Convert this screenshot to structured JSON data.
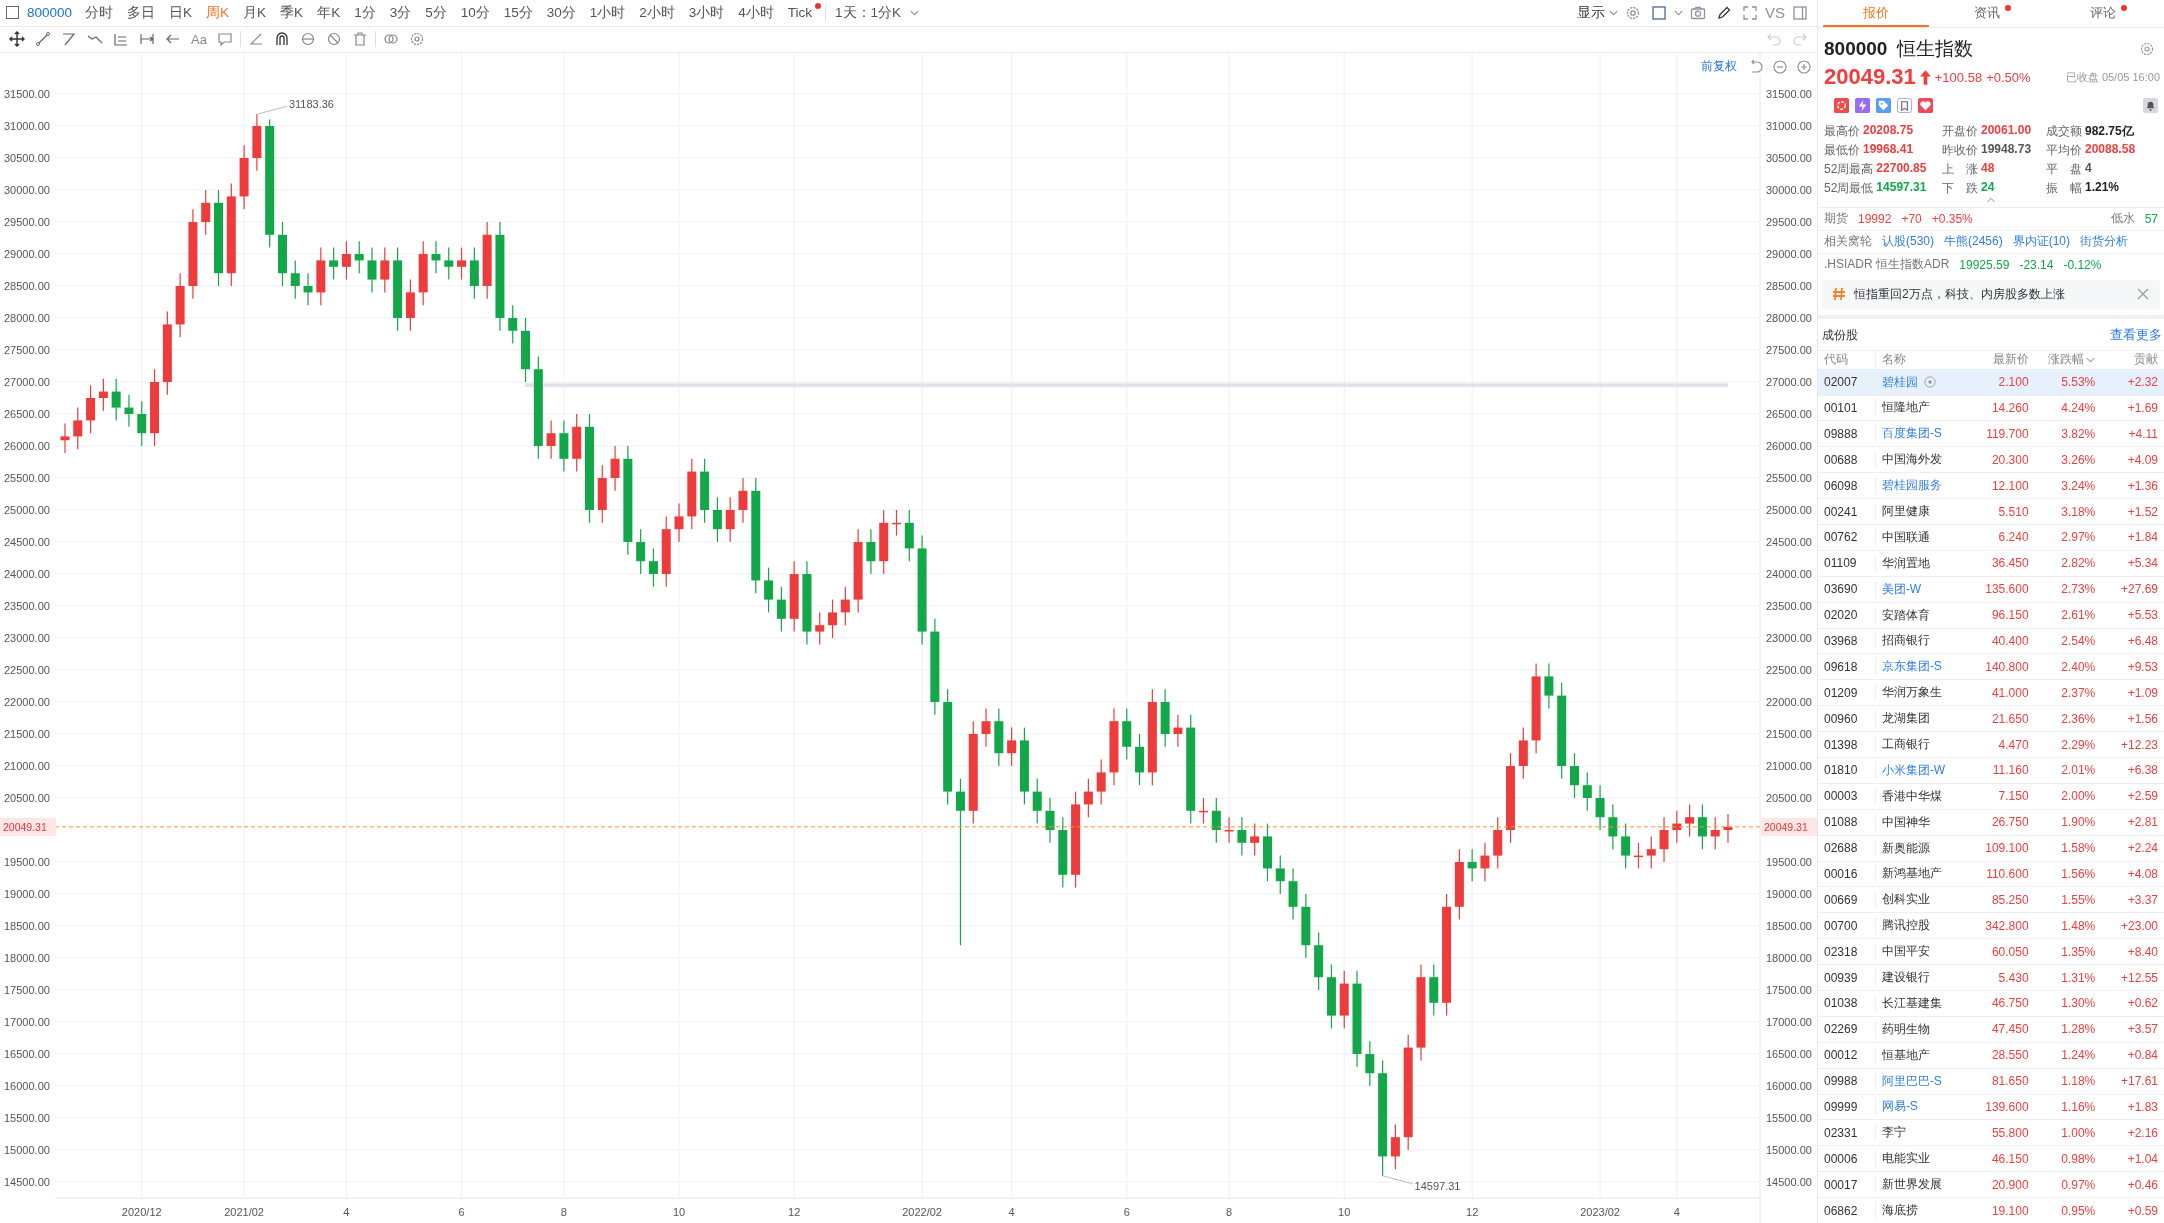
{
  "toolbar": {
    "symbol": "800000",
    "periods": [
      {
        "label": "分时",
        "selected": false,
        "badge": false
      },
      {
        "label": "多日",
        "selected": false,
        "badge": false
      },
      {
        "label": "日K",
        "selected": false,
        "badge": false
      },
      {
        "label": "周K",
        "selected": true,
        "badge": false
      },
      {
        "label": "月K",
        "selected": false,
        "badge": false
      },
      {
        "label": "季K",
        "selected": false,
        "badge": false
      },
      {
        "label": "年K",
        "selected": false,
        "badge": false
      },
      {
        "label": "1分",
        "selected": false,
        "badge": false
      },
      {
        "label": "3分",
        "selected": false,
        "badge": false
      },
      {
        "label": "5分",
        "selected": false,
        "badge": false
      },
      {
        "label": "10分",
        "selected": false,
        "badge": false
      },
      {
        "label": "15分",
        "selected": false,
        "badge": false
      },
      {
        "label": "30分",
        "selected": false,
        "badge": false
      },
      {
        "label": "1小时",
        "selected": false,
        "badge": false
      },
      {
        "label": "2小时",
        "selected": false,
        "badge": false
      },
      {
        "label": "3小时",
        "selected": false,
        "badge": false
      },
      {
        "label": "4小时",
        "selected": false,
        "badge": false
      },
      {
        "label": "Tick",
        "selected": false,
        "badge": true
      }
    ],
    "interval": "1天：1分K",
    "display": "显示",
    "vs": "VS",
    "text_tool": "Aa",
    "adjust": "前复权"
  },
  "chart": {
    "chart_data": {
      "type": "candlestick",
      "grid": true,
      "ylim": [
        14500,
        31500
      ],
      "yticks": [
        {
          "value": 31500,
          "label": "31500.00"
        },
        {
          "value": 31000,
          "label": "31000.00"
        },
        {
          "value": 30500,
          "label": "30500.00"
        },
        {
          "value": 30000,
          "label": "30000.00"
        },
        {
          "value": 29500,
          "label": "29500.00"
        },
        {
          "value": 29000,
          "label": "29000.00"
        },
        {
          "value": 28500,
          "label": "28500.00"
        },
        {
          "value": 28000,
          "label": "28000.00"
        },
        {
          "value": 27500,
          "label": "27500.00"
        },
        {
          "value": 27000,
          "label": "27000.00"
        },
        {
          "value": 26500,
          "label": "26500.00"
        },
        {
          "value": 26000,
          "label": "26000.00"
        },
        {
          "value": 25500,
          "label": "25500.00"
        },
        {
          "value": 25000,
          "label": "25000.00"
        },
        {
          "value": 24500,
          "label": "24500.00"
        },
        {
          "value": 24000,
          "label": "24000.00"
        },
        {
          "value": 23500,
          "label": "23500.00"
        },
        {
          "value": 23000,
          "label": "23000.00"
        },
        {
          "value": 22500,
          "label": "22500.00"
        },
        {
          "value": 22000,
          "label": "22000.00"
        },
        {
          "value": 21500,
          "label": "21500.00"
        },
        {
          "value": 21000,
          "label": "21000.00"
        },
        {
          "value": 20500,
          "label": "20500.00"
        },
        {
          "value": 19500,
          "label": "19500.00"
        },
        {
          "value": 19000,
          "label": "19000.00"
        },
        {
          "value": 18500,
          "label": "18500.00"
        },
        {
          "value": 18000,
          "label": "18000.00"
        },
        {
          "value": 17500,
          "label": "17500.00"
        },
        {
          "value": 17000,
          "label": "17000.00"
        },
        {
          "value": 16500,
          "label": "16500.00"
        },
        {
          "value": 16000,
          "label": "16000.00"
        },
        {
          "value": 15500,
          "label": "15500.00"
        },
        {
          "value": 15000,
          "label": "15000.00"
        },
        {
          "value": 14500,
          "label": "14500.00"
        }
      ],
      "categories": [
        null,
        null,
        null,
        null,
        null,
        null,
        "2020/12",
        null,
        null,
        null,
        null,
        null,
        null,
        null,
        "2021/02",
        null,
        null,
        null,
        null,
        null,
        null,
        null,
        "4",
        null,
        null,
        null,
        null,
        null,
        null,
        null,
        null,
        "6",
        null,
        null,
        null,
        null,
        null,
        null,
        null,
        "8",
        null,
        null,
        null,
        null,
        null,
        null,
        null,
        null,
        "10",
        null,
        null,
        null,
        null,
        null,
        null,
        null,
        null,
        "12",
        null,
        null,
        null,
        null,
        null,
        null,
        null,
        null,
        null,
        "2022/02",
        null,
        null,
        null,
        null,
        null,
        null,
        "4",
        null,
        null,
        null,
        null,
        null,
        null,
        null,
        null,
        "6",
        null,
        null,
        null,
        null,
        null,
        null,
        null,
        "8",
        null,
        null,
        null,
        null,
        null,
        null,
        null,
        null,
        "10",
        null,
        null,
        null,
        null,
        null,
        null,
        null,
        null,
        null,
        "12",
        null,
        null,
        null,
        null,
        null,
        null,
        null,
        null,
        null,
        "2023/02",
        null,
        null,
        null,
        null,
        null,
        "4",
        null,
        null,
        null,
        null
      ],
      "ohlc": [
        [
          26090,
          26350,
          25890,
          26150
        ],
        [
          26150,
          26600,
          25950,
          26400
        ],
        [
          26400,
          26950,
          26200,
          26750
        ],
        [
          26750,
          27050,
          26550,
          26850
        ],
        [
          26850,
          27050,
          26400,
          26600
        ],
        [
          26600,
          26800,
          26300,
          26500
        ],
        [
          26500,
          26700,
          26000,
          26200
        ],
        [
          26200,
          27200,
          26000,
          27000
        ],
        [
          27000,
          28100,
          26800,
          27900
        ],
        [
          27900,
          28700,
          27700,
          28500
        ],
        [
          28500,
          29700,
          28300,
          29500
        ],
        [
          29500,
          30000,
          29300,
          29800
        ],
        [
          29800,
          30000,
          28500,
          28700
        ],
        [
          28700,
          30100,
          28500,
          29900
        ],
        [
          29900,
          30700,
          29700,
          30500
        ],
        [
          30500,
          31183.36,
          30300,
          31000
        ],
        [
          31000,
          31100,
          29100,
          29300
        ],
        [
          29300,
          29500,
          28500,
          28700
        ],
        [
          28700,
          28900,
          28300,
          28500
        ],
        [
          28500,
          28700,
          28200,
          28400
        ],
        [
          28400,
          29100,
          28200,
          28900
        ],
        [
          28900,
          29100,
          28600,
          28800
        ],
        [
          28800,
          29200,
          28600,
          29000
        ],
        [
          29000,
          29200,
          28700,
          28900
        ],
        [
          28900,
          29100,
          28400,
          28600
        ],
        [
          28600,
          29100,
          28400,
          28900
        ],
        [
          28900,
          29100,
          27800,
          28000
        ],
        [
          28000,
          28600,
          27800,
          28400
        ],
        [
          28400,
          29200,
          28200,
          29000
        ],
        [
          29000,
          29200,
          28700,
          28900
        ],
        [
          28900,
          29100,
          28600,
          28800
        ],
        [
          28800,
          29100,
          28600,
          28900
        ],
        [
          28900,
          29100,
          28300,
          28500
        ],
        [
          28500,
          29500,
          28300,
          29300
        ],
        [
          29300,
          29500,
          27800,
          28000
        ],
        [
          28000,
          28200,
          27600,
          27800
        ],
        [
          27800,
          28000,
          27000,
          27200
        ],
        [
          27200,
          27400,
          25800,
          26000
        ],
        [
          26000,
          26400,
          25800,
          26200
        ],
        [
          26200,
          26400,
          25600,
          25800
        ],
        [
          25800,
          26500,
          25600,
          26300
        ],
        [
          26300,
          26500,
          24800,
          25000
        ],
        [
          25000,
          25700,
          24800,
          25500
        ],
        [
          25500,
          26000,
          25300,
          25800
        ],
        [
          25800,
          26000,
          24300,
          24500
        ],
        [
          24500,
          24700,
          24000,
          24200
        ],
        [
          24200,
          24400,
          23800,
          24000
        ],
        [
          24000,
          24900,
          23800,
          24700
        ],
        [
          24700,
          25100,
          24500,
          24900
        ],
        [
          24900,
          25800,
          24700,
          25600
        ],
        [
          25600,
          25800,
          24800,
          25000
        ],
        [
          25000,
          25200,
          24500,
          24700
        ],
        [
          24700,
          25200,
          24500,
          25000
        ],
        [
          25000,
          25500,
          24800,
          25300
        ],
        [
          25300,
          25500,
          23700,
          23900
        ],
        [
          23900,
          24100,
          23400,
          23600
        ],
        [
          23600,
          23800,
          23100,
          23300
        ],
        [
          23300,
          24200,
          23100,
          24000
        ],
        [
          24000,
          24200,
          22900,
          23100
        ],
        [
          23100,
          23400,
          22900,
          23200
        ],
        [
          23200,
          23600,
          23000,
          23400
        ],
        [
          23400,
          23800,
          23200,
          23600
        ],
        [
          23600,
          24700,
          23400,
          24500
        ],
        [
          24500,
          24700,
          24000,
          24200
        ],
        [
          24200,
          25000,
          24000,
          24800
        ],
        [
          24800,
          25000,
          24600,
          24800
        ],
        [
          24800,
          25000,
          24200,
          24400
        ],
        [
          24400,
          24600,
          22900,
          23100
        ],
        [
          23100,
          23300,
          21800,
          22000
        ],
        [
          22000,
          22200,
          20400,
          20600
        ],
        [
          20600,
          20800,
          18200,
          20300
        ],
        [
          20300,
          21700,
          20100,
          21500
        ],
        [
          21500,
          21900,
          21300,
          21700
        ],
        [
          21700,
          21900,
          21000,
          21200
        ],
        [
          21200,
          21600,
          21000,
          21400
        ],
        [
          21400,
          21600,
          20400,
          20600
        ],
        [
          20600,
          20800,
          20100,
          20300
        ],
        [
          20300,
          20500,
          19800,
          20000
        ],
        [
          20000,
          20200,
          19100,
          19300
        ],
        [
          19300,
          20600,
          19100,
          20400
        ],
        [
          20400,
          20800,
          20200,
          20600
        ],
        [
          20600,
          21100,
          20400,
          20900
        ],
        [
          20900,
          21900,
          20700,
          21700
        ],
        [
          21700,
          21900,
          21100,
          21300
        ],
        [
          21300,
          21500,
          20700,
          20900
        ],
        [
          20900,
          22200,
          20700,
          22000
        ],
        [
          22000,
          22200,
          21300,
          21500
        ],
        [
          21500,
          21800,
          21300,
          21600
        ],
        [
          21600,
          21800,
          20100,
          20300
        ],
        [
          20300,
          20500,
          20100,
          20300
        ],
        [
          20300,
          20500,
          19800,
          20000
        ],
        [
          20000,
          20200,
          19800,
          20000
        ],
        [
          20000,
          20200,
          19600,
          19800
        ],
        [
          19800,
          20100,
          19600,
          19900
        ],
        [
          19900,
          20100,
          19200,
          19400
        ],
        [
          19400,
          19600,
          19000,
          19200
        ],
        [
          19200,
          19400,
          18600,
          18800
        ],
        [
          18800,
          19000,
          18000,
          18200
        ],
        [
          18200,
          18400,
          17500,
          17700
        ],
        [
          17700,
          17900,
          16900,
          17100
        ],
        [
          17100,
          17800,
          16900,
          17600
        ],
        [
          17600,
          17800,
          16300,
          16500
        ],
        [
          16500,
          16700,
          16000,
          16200
        ],
        [
          16200,
          16400,
          14597.31,
          14900
        ],
        [
          14900,
          15400,
          14700,
          15200
        ],
        [
          15200,
          16800,
          15000,
          16600
        ],
        [
          16600,
          17900,
          16400,
          17700
        ],
        [
          17700,
          17900,
          17100,
          17300
        ],
        [
          17300,
          19000,
          17100,
          18800
        ],
        [
          18800,
          19700,
          18600,
          19500
        ],
        [
          19500,
          19700,
          19200,
          19400
        ],
        [
          19400,
          19800,
          19200,
          19600
        ],
        [
          19600,
          20200,
          19400,
          20000
        ],
        [
          20000,
          21200,
          19800,
          21000
        ],
        [
          21000,
          21600,
          20800,
          21400
        ],
        [
          21400,
          22600,
          21200,
          22400
        ],
        [
          22400,
          22600,
          21900,
          22100
        ],
        [
          22100,
          22300,
          20800,
          21000
        ],
        [
          21000,
          21200,
          20500,
          20700
        ],
        [
          20700,
          20900,
          20300,
          20500
        ],
        [
          20500,
          20700,
          20000,
          20200
        ],
        [
          20200,
          20400,
          19700,
          19900
        ],
        [
          19900,
          20100,
          19400,
          19600
        ],
        [
          19600,
          19800,
          19400,
          19600
        ],
        [
          19600,
          19900,
          19400,
          19700
        ],
        [
          19700,
          20200,
          19500,
          20000
        ],
        [
          20000,
          20300,
          19800,
          20100
        ],
        [
          20100,
          20400,
          19900,
          20200
        ],
        [
          20200,
          20400,
          19700,
          19900
        ],
        [
          19900,
          20200,
          19700,
          20000
        ],
        [
          20000,
          20250,
          19800,
          20050
        ]
      ],
      "annotations": [
        "31183.36",
        "14597.31"
      ],
      "ref_lines": [
        {
          "axis": "y",
          "value": 20049.31,
          "label": "20049.31"
        }
      ],
      "bands": [
        {
          "axis": "y",
          "from": 26920,
          "to": 26980
        }
      ]
    }
  },
  "panel": {
    "tabs": [
      {
        "label": "报价",
        "selected": true,
        "badge": false
      },
      {
        "label": "资讯",
        "selected": false,
        "badge": true
      },
      {
        "label": "评论",
        "selected": false,
        "badge": true
      }
    ],
    "code": "800000",
    "name": "恒生指数",
    "price": "20049.31",
    "change": "+100.58",
    "change_pct": "+0.50%",
    "status": "已收盘 05/05 16:00",
    "stats": [
      {
        "label": "最高价",
        "value": "20208.75",
        "color": "#f03d3d"
      },
      {
        "label": "开盘价",
        "value": "20061.00",
        "color": "#f03d3d"
      },
      {
        "label": "成交额",
        "value": "982.75亿",
        "color": "#222222"
      },
      {
        "label": "最低价",
        "value": "19968.41",
        "color": "#f03d3d"
      },
      {
        "label": "昨收价",
        "value": "19948.73",
        "color": "#555555"
      },
      {
        "label": "平均价",
        "value": "20088.58",
        "color": "#f03d3d"
      },
      {
        "label": "52周最高",
        "value": "22700.85",
        "color": "#f03d3d"
      },
      {
        "label": "上　涨",
        "value": "48",
        "color": "#f03d3d"
      },
      {
        "label": "平　盘",
        "value": "4",
        "color": "#555555"
      },
      {
        "label": "52周最低",
        "value": "14597.31",
        "color": "#10a84a"
      },
      {
        "label": "下　跌",
        "value": "24",
        "color": "#10a84a"
      },
      {
        "label": "振　幅",
        "value": "1.21%",
        "color": "#222222"
      }
    ],
    "futures": {
      "label": "期货",
      "price": "19992",
      "change": "+70",
      "change_pct": "+0.35%",
      "basis_label": "低水",
      "basis": "57"
    },
    "warrants": {
      "label": "相关窝轮",
      "links": [
        "认股(530)",
        "牛熊(2456)",
        "界内证(10)",
        "街货分析"
      ]
    },
    "adr": {
      "label": ".HSIADR 恒生指数ADR",
      "price": "19925.59",
      "change": "-23.14",
      "change_pct": "-0.12%"
    },
    "news": "恒指重回2万点，科技、内房股多数上涨",
    "constituents": {
      "title": "成份股",
      "more": "查看更多",
      "columns": [
        "代码",
        "名称",
        "最新价",
        "涨跌幅",
        "贡献"
      ],
      "rows": [
        {
          "code": "02007",
          "name": "碧桂园",
          "price": "2.100",
          "pct": "5.53%",
          "contrib": "+2.32",
          "linked": true,
          "selected": true
        },
        {
          "code": "00101",
          "name": "恒隆地产",
          "price": "14.260",
          "pct": "4.24%",
          "contrib": "+1.69",
          "linked": false,
          "selected": false
        },
        {
          "code": "09888",
          "name": "百度集团-S",
          "price": "119.700",
          "pct": "3.82%",
          "contrib": "+4.11",
          "linked": true,
          "selected": false
        },
        {
          "code": "00688",
          "name": "中国海外发",
          "price": "20.300",
          "pct": "3.26%",
          "contrib": "+4.09",
          "linked": false,
          "selected": false
        },
        {
          "code": "06098",
          "name": "碧桂园服务",
          "price": "12.100",
          "pct": "3.24%",
          "contrib": "+1.36",
          "linked": true,
          "selected": false
        },
        {
          "code": "00241",
          "name": "阿里健康",
          "price": "5.510",
          "pct": "3.18%",
          "contrib": "+1.52",
          "linked": false,
          "selected": false
        },
        {
          "code": "00762",
          "name": "中国联通",
          "price": "6.240",
          "pct": "2.97%",
          "contrib": "+1.84",
          "linked": false,
          "selected": false
        },
        {
          "code": "01109",
          "name": "华润置地",
          "price": "36.450",
          "pct": "2.82%",
          "contrib": "+5.34",
          "linked": false,
          "selected": false
        },
        {
          "code": "03690",
          "name": "美团-W",
          "price": "135.600",
          "pct": "2.73%",
          "contrib": "+27.69",
          "linked": true,
          "selected": false
        },
        {
          "code": "02020",
          "name": "安踏体育",
          "price": "96.150",
          "pct": "2.61%",
          "contrib": "+5.53",
          "linked": false,
          "selected": false
        },
        {
          "code": "03968",
          "name": "招商银行",
          "price": "40.400",
          "pct": "2.54%",
          "contrib": "+6.48",
          "linked": false,
          "selected": false
        },
        {
          "code": "09618",
          "name": "京东集团-S",
          "price": "140.800",
          "pct": "2.40%",
          "contrib": "+9.53",
          "linked": true,
          "selected": false
        },
        {
          "code": "01209",
          "name": "华润万象生",
          "price": "41.000",
          "pct": "2.37%",
          "contrib": "+1.09",
          "linked": false,
          "selected": false
        },
        {
          "code": "00960",
          "name": "龙湖集团",
          "price": "21.650",
          "pct": "2.36%",
          "contrib": "+1.56",
          "linked": false,
          "selected": false
        },
        {
          "code": "01398",
          "name": "工商银行",
          "price": "4.470",
          "pct": "2.29%",
          "contrib": "+12.23",
          "linked": false,
          "selected": false
        },
        {
          "code": "01810",
          "name": "小米集团-W",
          "price": "11.160",
          "pct": "2.01%",
          "contrib": "+6.38",
          "linked": true,
          "selected": false
        },
        {
          "code": "00003",
          "name": "香港中华煤",
          "price": "7.150",
          "pct": "2.00%",
          "contrib": "+2.59",
          "linked": false,
          "selected": false
        },
        {
          "code": "01088",
          "name": "中国神华",
          "price": "26.750",
          "pct": "1.90%",
          "contrib": "+2.81",
          "linked": false,
          "selected": false
        },
        {
          "code": "02688",
          "name": "新奥能源",
          "price": "109.100",
          "pct": "1.58%",
          "contrib": "+2.24",
          "linked": false,
          "selected": false
        },
        {
          "code": "00016",
          "name": "新鸿基地产",
          "price": "110.600",
          "pct": "1.56%",
          "contrib": "+4.08",
          "linked": false,
          "selected": false
        },
        {
          "code": "00669",
          "name": "创科实业",
          "price": "85.250",
          "pct": "1.55%",
          "contrib": "+3.37",
          "linked": false,
          "selected": false
        },
        {
          "code": "00700",
          "name": "腾讯控股",
          "price": "342.800",
          "pct": "1.48%",
          "contrib": "+23.00",
          "linked": false,
          "selected": false
        },
        {
          "code": "02318",
          "name": "中国平安",
          "price": "60.050",
          "pct": "1.35%",
          "contrib": "+8.40",
          "linked": false,
          "selected": false
        },
        {
          "code": "00939",
          "name": "建设银行",
          "price": "5.430",
          "pct": "1.31%",
          "contrib": "+12.55",
          "linked": false,
          "selected": false
        },
        {
          "code": "01038",
          "name": "长江基建集",
          "price": "46.750",
          "pct": "1.30%",
          "contrib": "+0.62",
          "linked": false,
          "selected": false
        },
        {
          "code": "02269",
          "name": "药明生物",
          "price": "47.450",
          "pct": "1.28%",
          "contrib": "+3.57",
          "linked": false,
          "selected": false
        },
        {
          "code": "00012",
          "name": "恒基地产",
          "price": "28.550",
          "pct": "1.24%",
          "contrib": "+0.84",
          "linked": false,
          "selected": false
        },
        {
          "code": "09988",
          "name": "阿里巴巴-S",
          "price": "81.650",
          "pct": "1.18%",
          "contrib": "+17.61",
          "linked": true,
          "selected": false
        },
        {
          "code": "09999",
          "name": "网易-S",
          "price": "139.600",
          "pct": "1.16%",
          "contrib": "+1.83",
          "linked": true,
          "selected": false
        },
        {
          "code": "02331",
          "name": "李宁",
          "price": "55.800",
          "pct": "1.00%",
          "contrib": "+2.16",
          "linked": false,
          "selected": false
        },
        {
          "code": "00006",
          "name": "电能实业",
          "price": "46.150",
          "pct": "0.98%",
          "contrib": "+1.04",
          "linked": false,
          "selected": false
        },
        {
          "code": "00017",
          "name": "新世界发展",
          "price": "20.900",
          "pct": "0.97%",
          "contrib": "+0.46",
          "linked": false,
          "selected": false
        },
        {
          "code": "06862",
          "name": "海底捞",
          "price": "19.100",
          "pct": "0.95%",
          "contrib": "+0.59",
          "linked": false,
          "selected": false
        }
      ]
    }
  }
}
